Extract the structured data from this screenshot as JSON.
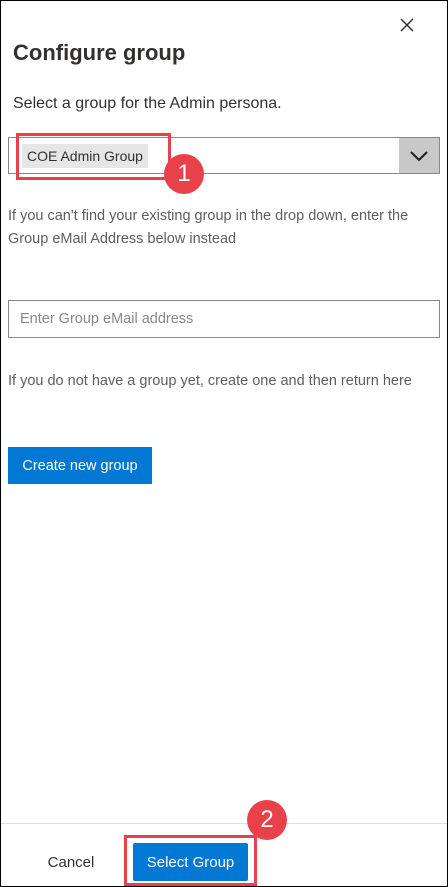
{
  "panel": {
    "title": "Configure group",
    "subtitle": "Select a group for the Admin persona.",
    "dropdown": {
      "selected": "COE Admin Group"
    },
    "help_text_1": "If you can't find your existing group in the drop down, enter the Group eMail Address below instead",
    "email_input": {
      "value": "",
      "placeholder": "Enter Group eMail address"
    },
    "help_text_2": "If you do not have a group yet, create one and then return here",
    "create_button": "Create new group"
  },
  "footer": {
    "cancel_label": "Cancel",
    "select_label": "Select Group"
  },
  "annotations": {
    "badge_1": "1",
    "badge_2": "2"
  },
  "colors": {
    "accent": "#0078d4",
    "highlight": "#e8414a"
  }
}
